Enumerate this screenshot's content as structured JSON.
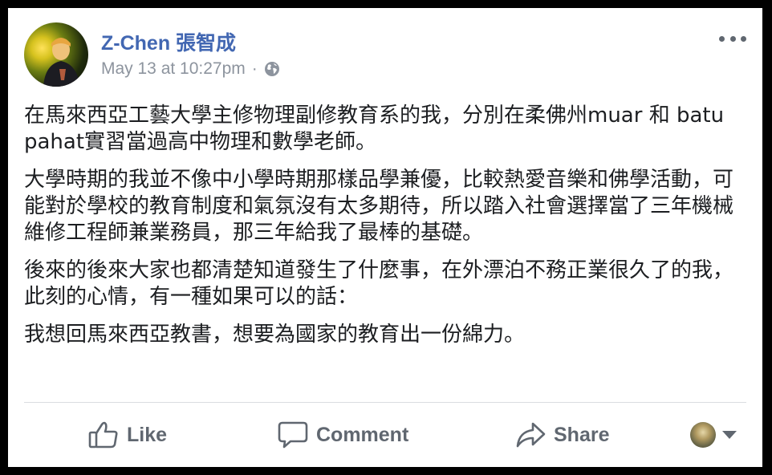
{
  "post": {
    "author": "Z-Chen 張智成",
    "timestamp": "May 13 at 10:27pm",
    "separator": "·",
    "privacy_icon": "globe-icon",
    "more_icon": "more-options-icon",
    "paragraphs": [
      "在馬來西亞工藝大學主修物理副修教育系的我，分別在柔佛州muar 和 batu pahat實習當過高中物理和數學老師。",
      "大學時期的我並不像中小學時期那樣品學兼優，比較熱愛音樂和佛學活動，可能對於學校的教育制度和氣氛沒有太多期待，所以踏入社會選擇當了三年機械維修工程師兼業務員，那三年給我了最棒的基礎。",
      "後來的後來大家也都清楚知道發生了什麼事，在外漂泊不務正業很久了的我，此刻的心情，有一種如果可以的話：",
      "我想回馬來西亞教書，想要為國家的教育出一份綿力。"
    ]
  },
  "actions": {
    "like_label": "Like",
    "comment_label": "Comment",
    "share_label": "Share",
    "like_icon": "thumbs-up-icon",
    "comment_icon": "comment-bubble-icon",
    "share_icon": "share-arrow-icon",
    "audience_icon": "chevron-down-icon"
  },
  "colors": {
    "author_link": "#4267b2",
    "meta_text": "#8d949e",
    "body_text": "#1c1e21",
    "action_text": "#606770",
    "divider": "#dadde1",
    "frame": "#000000"
  }
}
